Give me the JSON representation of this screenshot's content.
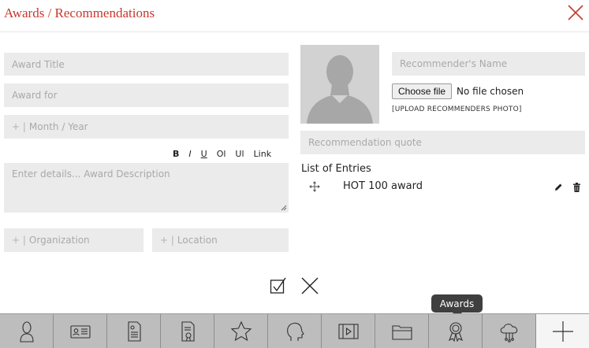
{
  "header": {
    "title": "Awards / Recommendations"
  },
  "form": {
    "award_title_placeholder": "Award Title",
    "award_for_placeholder": "Award for",
    "month_year_plus": "+ |",
    "month_year_placeholder": "Month / Year",
    "toolbar": {
      "bold": "B",
      "italic": "I",
      "underline": "U",
      "ordered_list": "Ol",
      "unordered_list": "Ul",
      "link": "Link"
    },
    "description_placeholder": "Enter details... Award Description",
    "organization_plus": "+ |",
    "organization_placeholder": "Organization",
    "location_plus": "+ |",
    "location_placeholder": "Location"
  },
  "recommender": {
    "name_placeholder": "Recommender's Name",
    "file_button": "Choose file",
    "file_status": "No file chosen",
    "upload_note": "[UPLOAD RECOMMENDERS PHOTO]",
    "quote_placeholder": "Recommendation quote"
  },
  "entries": {
    "title": "List of Entries",
    "items": [
      {
        "label": "HOT 100 award"
      }
    ]
  },
  "tooltip": "Awards",
  "bottom_nav": [
    {
      "icon": "person-icon"
    },
    {
      "icon": "id-card-icon"
    },
    {
      "icon": "document-icon"
    },
    {
      "icon": "certificate-icon"
    },
    {
      "icon": "star-icon"
    },
    {
      "icon": "head-profile-icon"
    },
    {
      "icon": "film-icon"
    },
    {
      "icon": "folder-icon"
    },
    {
      "icon": "award-ribbon-icon"
    },
    {
      "icon": "cloud-network-icon"
    },
    {
      "icon": "plus-icon"
    }
  ],
  "colors": {
    "accent": "#c8382f",
    "field_bg": "#ebebeb",
    "bar_bg": "#bdbdbd",
    "tooltip_bg": "#3f3f3f"
  }
}
